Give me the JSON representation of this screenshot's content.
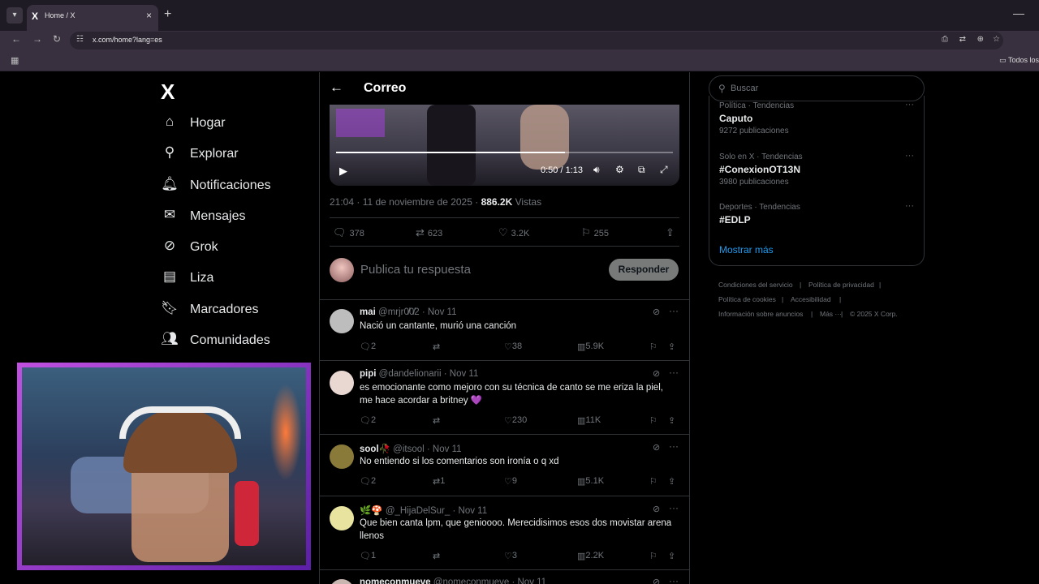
{
  "browser": {
    "tab_title": "Home / X",
    "tab_favicon": "X",
    "url": "x.com/home?lang=es",
    "bookmarks_all": "Todos los"
  },
  "sidebar": {
    "logo": "X",
    "items": [
      {
        "label": "Hogar",
        "icon": "home-icon"
      },
      {
        "label": "Explorar",
        "icon": "search-icon"
      },
      {
        "label": "Notificaciones",
        "icon": "bell-icon"
      },
      {
        "label": "Mensajes",
        "icon": "mail-icon"
      },
      {
        "label": "Grok",
        "icon": "grok-icon"
      },
      {
        "label": "Liza",
        "icon": "list-icon"
      },
      {
        "label": "Marcadores",
        "icon": "bookmark-icon"
      },
      {
        "label": "Comunidades",
        "icon": "communities-icon"
      }
    ]
  },
  "header": {
    "title": "Correo"
  },
  "video": {
    "time": "0:50 / 1:13",
    "progress": 0.68
  },
  "post": {
    "timestamp": "21:04 · 11 de noviembre de 2025 ·",
    "views_count": "886.2K",
    "views_label": "Vistas",
    "replies": "378",
    "reposts": "623",
    "likes": "3.2K",
    "bookmarks": "255"
  },
  "compose": {
    "placeholder": "Publica tu respuesta",
    "button": "Responder"
  },
  "replies": [
    {
      "name": "mai",
      "handle": "@mrjr0̸0̸2",
      "date": "· Nov 11",
      "text": "Nació un cantante, murió una canción",
      "replies": "2",
      "reposts": "",
      "likes": "38",
      "views": "5.9K"
    },
    {
      "name": "pipi",
      "handle": "@dandelionarii",
      "date": "· Nov 11",
      "text": "es emocionante como mejoro con su técnica de canto se me eriza la piel, me hace acordar a britney 💜",
      "replies": "2",
      "reposts": "",
      "likes": "230",
      "views": "11K"
    },
    {
      "name": "sool🥀",
      "handle": "@itsool",
      "date": "· Nov 11",
      "text": "No entiendo si los comentarios son ironía o q xd",
      "replies": "2",
      "reposts": "1",
      "likes": "9",
      "views": "5.1K"
    },
    {
      "name": "🌿🍄",
      "handle": "@_HijaDelSur_",
      "date": "· Nov 11",
      "text": "Que bien canta lpm, que genioooo. Merecidisimos esos dos movistar arena llenos",
      "replies": "1",
      "reposts": "",
      "likes": "3",
      "views": "2.2K"
    },
    {
      "name": "nomeconmueve",
      "handle": "@nomeconmueve",
      "date": "· Nov 11",
      "text": "",
      "replies": "",
      "reposts": "",
      "likes": "",
      "views": ""
    }
  ],
  "right": {
    "search_placeholder": "Buscar",
    "trends": [
      {
        "category": "Política · Tendencias",
        "name": "Caputo",
        "count": "9272 publicaciones"
      },
      {
        "category": "Solo en X · Tendencias",
        "name": "#ConexionOT13N",
        "count": "3980 publicaciones"
      },
      {
        "category": "Deportes · Tendencias",
        "name": "#EDLP",
        "count": ""
      }
    ],
    "show_more": "Mostrar más",
    "footer": [
      "Condiciones del servicio",
      "|",
      "Política de privacidad",
      "|",
      "Política de cookies",
      "|",
      "Accesibilidad",
      "|",
      "Información sobre anuncios",
      "|",
      "Más ···",
      "|",
      "© 2025 X Corp."
    ]
  },
  "colors": {
    "accent": "#1d9bf0",
    "border": "#2f3336",
    "muted": "#71767b",
    "cam_frame": "#b54be0"
  }
}
